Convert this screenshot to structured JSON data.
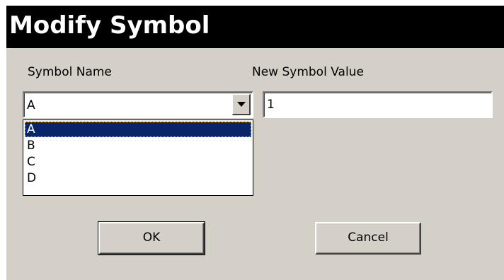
{
  "dialog": {
    "title": "Modify Symbol",
    "symbol_name_label": "Symbol Name",
    "new_value_label": "New Symbol Value",
    "symbol_name_selected": "A",
    "symbol_options": [
      {
        "label": "A",
        "selected": true
      },
      {
        "label": "B",
        "selected": false
      },
      {
        "label": "C",
        "selected": false
      },
      {
        "label": "D",
        "selected": false
      }
    ],
    "new_value": "1",
    "ok_label": "OK",
    "cancel_label": "Cancel"
  },
  "colors": {
    "title_bar": "#000000",
    "title_text": "#ffffff",
    "dialog_face": "#d4d0c8",
    "selection_highlight": "#0a246a",
    "selection_text": "#ffffff"
  },
  "icons": {
    "dropdown_button": "chevron-down-icon"
  }
}
